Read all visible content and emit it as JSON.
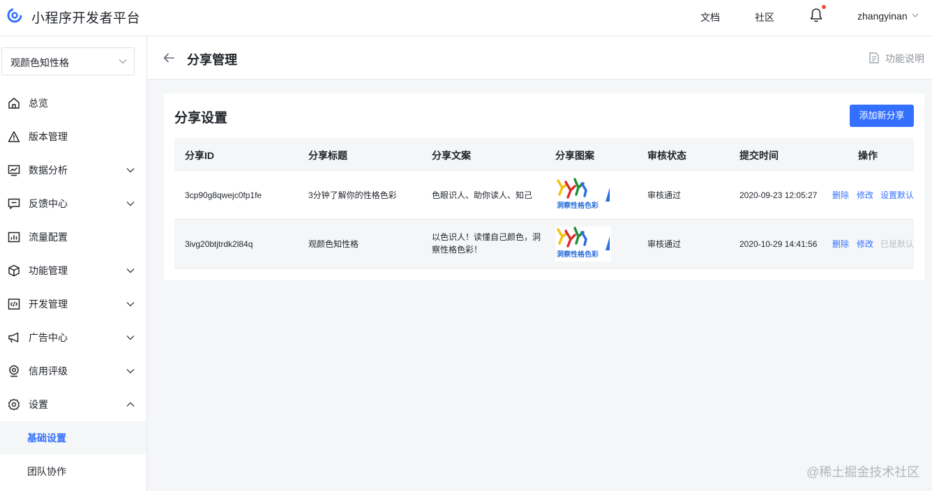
{
  "header": {
    "app_title": "小程序开发者平台",
    "links": {
      "docs": "文档",
      "community": "社区"
    },
    "username": "zhangyinan"
  },
  "sidebar": {
    "app_selector": "观颜色知性格",
    "items": [
      {
        "label": "总览",
        "icon": "home-icon"
      },
      {
        "label": "版本管理",
        "icon": "warning-triangle-icon"
      },
      {
        "label": "数据分析",
        "icon": "chart-icon"
      },
      {
        "label": "反馈中心",
        "icon": "message-icon"
      },
      {
        "label": "流量配置",
        "icon": "bar-chart-icon"
      },
      {
        "label": "功能管理",
        "icon": "cube-icon"
      },
      {
        "label": "开发管理",
        "icon": "code-icon"
      },
      {
        "label": "广告中心",
        "icon": "megaphone-icon"
      },
      {
        "label": "信用评级",
        "icon": "badge-icon"
      },
      {
        "label": "设置",
        "icon": "gear-icon"
      }
    ],
    "settings_sub": [
      {
        "label": "基础设置",
        "active": true
      },
      {
        "label": "团队协作",
        "active": false
      }
    ]
  },
  "page": {
    "title": "分享管理",
    "help_label": "功能说明"
  },
  "card": {
    "title": "分享设置",
    "add_button": "添加新分享"
  },
  "table": {
    "headers": [
      "分享ID",
      "分享标题",
      "分享文案",
      "分享图案",
      "审核状态",
      "提交时间",
      "操作"
    ],
    "rows": [
      {
        "id": "3cp90g8qwejc0fp1fe",
        "title": "3分钟了解你的性格色彩",
        "copy": "色眼识人、助你读人、知己",
        "image_text": "洞察性格色彩",
        "status": "审核通过",
        "time": "2020-09-23 12:05:27",
        "ops": {
          "delete": "删除",
          "edit": "修改",
          "default": "设置默认",
          "default_disabled": false
        }
      },
      {
        "id": "3ivg20btjtrdk2l84q",
        "title": "观颜色知性格",
        "copy": "以色识人！读懂自己颜色，洞察性格色彩！",
        "image_text": "洞察性格色彩",
        "status": "审核通过",
        "time": "2020-10-29 14:41:56",
        "ops": {
          "delete": "删除",
          "edit": "修改",
          "default": "已是默认",
          "default_disabled": true
        }
      }
    ]
  },
  "watermark": "@稀土掘金技术社区",
  "colors": {
    "primary": "#3370ff",
    "notification_dot": "#f54a45",
    "disabled": "#bbbfc4"
  }
}
